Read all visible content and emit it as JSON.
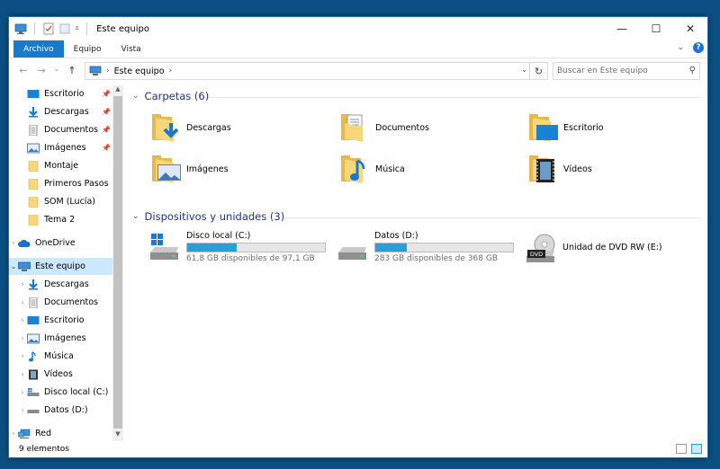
{
  "window": {
    "title": "Este equipo",
    "controls": {
      "minimize": "—",
      "maximize": "☐",
      "close": "✕"
    }
  },
  "ribbon": {
    "tabs": [
      "Archivo",
      "Equipo",
      "Vista"
    ],
    "help": "?"
  },
  "address": {
    "path": "Este equipo",
    "search_placeholder": "Buscar en Este equipo"
  },
  "nav": {
    "quick_access": [
      {
        "label": "Escritorio",
        "pinned": true
      },
      {
        "label": "Descargas",
        "pinned": true
      },
      {
        "label": "Documentos",
        "pinned": true
      },
      {
        "label": "Imágenes",
        "pinned": true
      },
      {
        "label": "Montaje",
        "pinned": false
      },
      {
        "label": "Primeros Pasos",
        "pinned": false
      },
      {
        "label": "SOM (Lucía)",
        "pinned": false
      },
      {
        "label": "Tema 2",
        "pinned": false
      }
    ],
    "onedrive": "OneDrive",
    "this_pc": "Este equipo",
    "this_pc_children": [
      "Descargas",
      "Documentos",
      "Escritorio",
      "Imágenes",
      "Música",
      "Vídeos",
      "Disco local (C:)",
      "Datos (D:)"
    ],
    "network": "Red"
  },
  "content": {
    "folders_header": "Carpetas (6)",
    "folders": [
      "Descargas",
      "Documentos",
      "Escritorio",
      "Imágenes",
      "Música",
      "Vídeos"
    ],
    "devices_header": "Dispositivos y unidades (3)",
    "drives": [
      {
        "name": "Disco local (C:)",
        "free": "61,8 GB disponibles de 97,1 GB",
        "used_fraction": 0.36
      },
      {
        "name": "Datos (D:)",
        "free": "283 GB disponibles de 368 GB",
        "used_fraction": 0.23
      }
    ],
    "dvd": {
      "name": "Unidad de DVD RW (E:)",
      "badge": "DVD"
    }
  },
  "status": {
    "items": "9 elementos"
  },
  "colors": {
    "accent": "#1979ca",
    "bar_fill": "#26a0da",
    "selection": "#cce8ff",
    "group_header": "#1e3287"
  }
}
